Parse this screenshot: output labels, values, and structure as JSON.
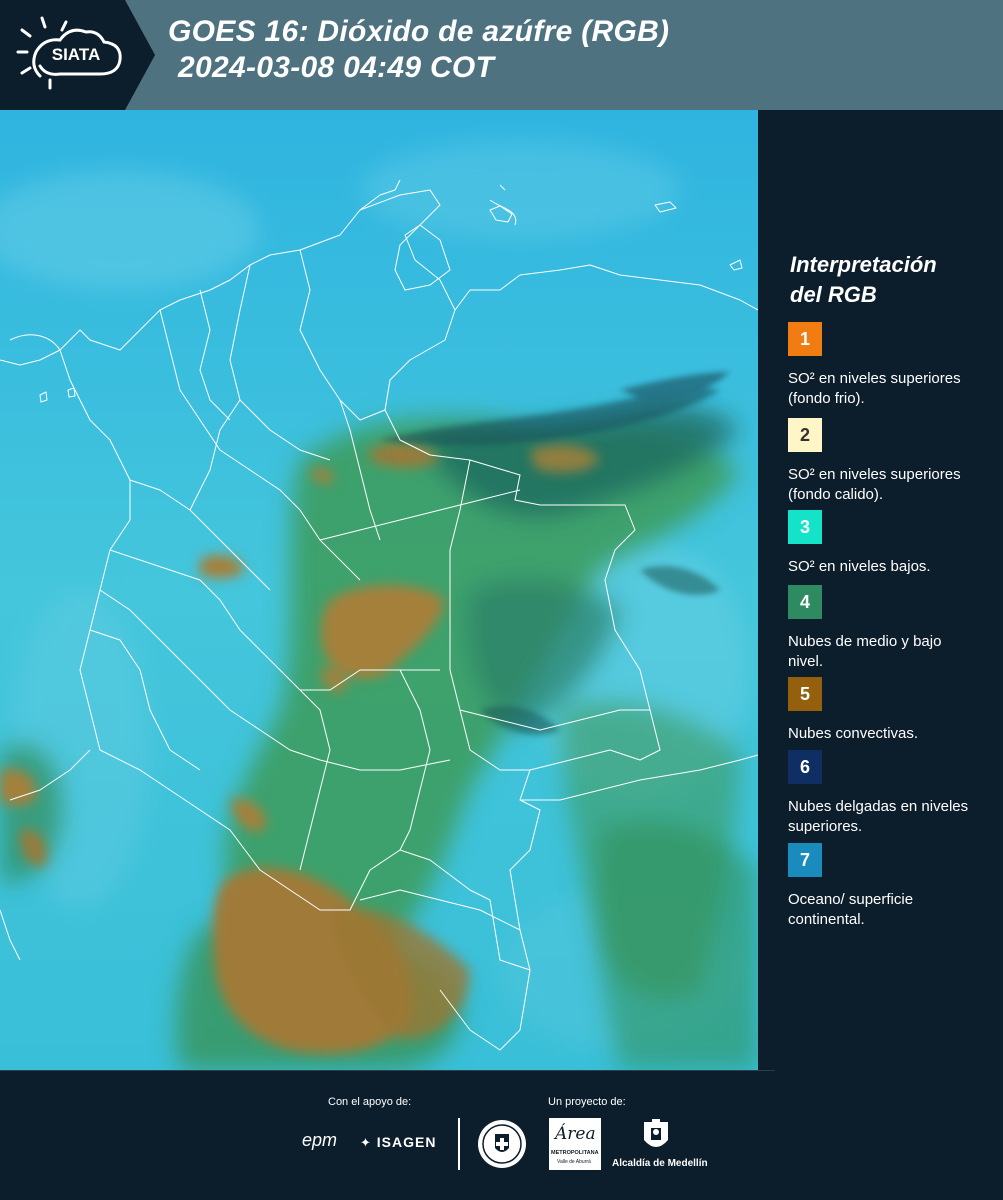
{
  "header": {
    "logo_text": "SIATA",
    "title_line1": "GOES 16: Dióxido de azúfre (RGB)",
    "title_line2": "2024-03-08 04:49 COT"
  },
  "legend": {
    "title_line1": "Interpretación",
    "title_line2": "del RGB",
    "items": [
      {
        "number": "1",
        "color": "#f07c12",
        "label": "SO² en niveles superiores (fondo frio)."
      },
      {
        "number": "2",
        "color": "#fff6c7",
        "label": "SO² en niveles superiores (fondo calido)."
      },
      {
        "number": "3",
        "color": "#14e3c9",
        "label": "SO² en niveles bajos."
      },
      {
        "number": "4",
        "color": "#2e8a60",
        "label": "Nubes de medio y bajo nivel."
      },
      {
        "number": "5",
        "color": "#94600e",
        "label": "Nubes convectivas."
      },
      {
        "number": "6",
        "color": "#0f2e63",
        "label": "Nubes delgadas en niveles superiores."
      },
      {
        "number": "7",
        "color": "#1a8bbd",
        "label": "Oceano/ superficie continental."
      }
    ]
  },
  "footer": {
    "support_label": "Con el apoyo de:",
    "project_label": "Un proyecto de:",
    "sponsor1": "epm",
    "sponsor2": "ISAGEN",
    "partner1_line1": "METROPOLITANA",
    "partner1_line2": "Valle de Aburrá",
    "partner1_script": "Área",
    "partner2": "Alcaldía de Medellín"
  },
  "colors": {
    "header_bg": "#4e7280",
    "logo_bg": "#0c1d2b",
    "page_bg": "#0c1d2b",
    "map_cyan": "#3cc3de",
    "map_green": "#2f8f55",
    "map_brown": "#a5803a"
  }
}
